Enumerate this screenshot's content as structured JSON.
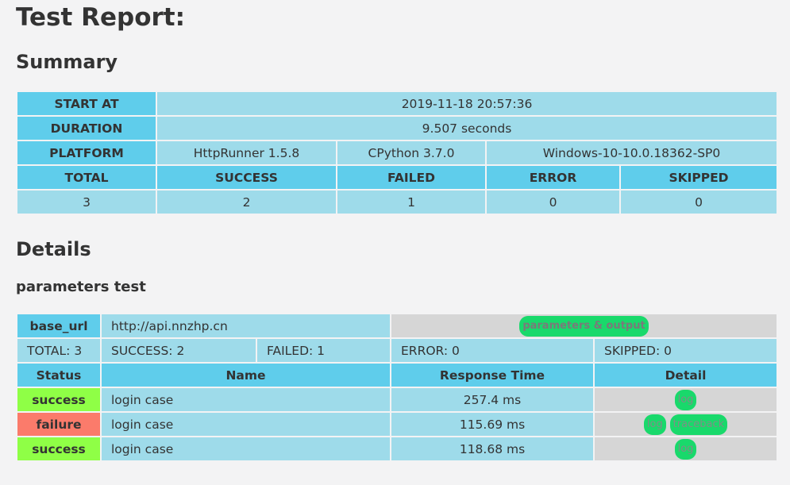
{
  "title": "Test Report:",
  "summary": {
    "heading": "Summary",
    "start_at_label": "START AT",
    "start_at": "2019-11-18 20:57:36",
    "duration_label": "DURATION",
    "duration": "9.507 seconds",
    "platform_label": "PLATFORM",
    "platform": [
      "HttpRunner 1.5.8",
      "CPython 3.7.0",
      "Windows-10-10.0.18362-SP0"
    ],
    "stat_headers": [
      "TOTAL",
      "SUCCESS",
      "FAILED",
      "ERROR",
      "SKIPPED"
    ],
    "stat_values": [
      "3",
      "2",
      "1",
      "0",
      "0"
    ]
  },
  "details": {
    "heading": "Details",
    "suite_name": "parameters test",
    "base_url_label": "base_url",
    "base_url": "http://api.nnzhp.cn",
    "params_button": "parameters & output",
    "totals": {
      "total": "TOTAL: 3",
      "success": "SUCCESS: 2",
      "failed": "FAILED: 1",
      "error": "ERROR: 0",
      "skipped": "SKIPPED: 0"
    },
    "columns": [
      "Status",
      "Name",
      "Response Time",
      "Detail"
    ],
    "rows": [
      {
        "status": "success",
        "name": "login case",
        "response_time": "257.4 ms",
        "detail": [
          "log"
        ]
      },
      {
        "status": "failure",
        "name": "login case",
        "response_time": "115.69 ms",
        "detail": [
          "log",
          "traceback"
        ]
      },
      {
        "status": "success",
        "name": "login case",
        "response_time": "118.68 ms",
        "detail": [
          "log"
        ]
      }
    ]
  },
  "colors": {
    "header_cell": "#5fcdeb",
    "value_cell": "#9edbea",
    "success": "#8fff46",
    "failure": "#fb7b6b",
    "button": "#19d96b"
  }
}
